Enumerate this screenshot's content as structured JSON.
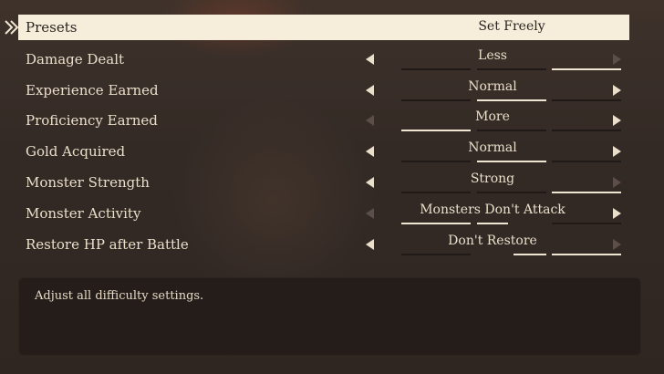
{
  "presets": {
    "label": "Presets",
    "value": "Set Freely"
  },
  "settings": [
    {
      "label": "Damage Dealt",
      "value": "Less",
      "left_enabled": true,
      "right_enabled": false,
      "level_index": 2
    },
    {
      "label": "Experience Earned",
      "value": "Normal",
      "left_enabled": true,
      "right_enabled": true,
      "level_index": 1
    },
    {
      "label": "Proficiency Earned",
      "value": "More",
      "left_enabled": false,
      "right_enabled": true,
      "level_index": 0
    },
    {
      "label": "Gold Acquired",
      "value": "Normal",
      "left_enabled": true,
      "right_enabled": true,
      "level_index": 1
    },
    {
      "label": "Monster Strength",
      "value": "Strong",
      "left_enabled": true,
      "right_enabled": false,
      "level_index": 2
    },
    {
      "label": "Monster Activity",
      "value": "Monsters Don't Attack",
      "left_enabled": false,
      "right_enabled": true,
      "level_index": 0.5
    },
    {
      "label": "Restore HP after Battle",
      "value": "Don't Restore",
      "left_enabled": true,
      "right_enabled": false,
      "level_index": 1.5
    }
  ],
  "description": "Adjust all difficulty settings.",
  "colors": {
    "highlight": "#f6eedb",
    "text": "#eadfca",
    "background": "#3a2f29",
    "panel": "#241d19"
  },
  "icons": {
    "cursor": "chevron-cursor-icon",
    "left": "triangle-left-icon",
    "right": "triangle-right-icon"
  }
}
